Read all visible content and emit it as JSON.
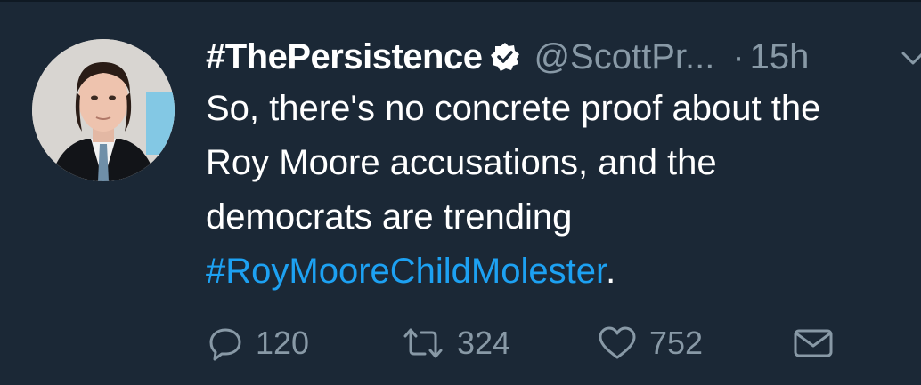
{
  "tweet": {
    "display_name": "#ThePersistence",
    "handle": "@ScottPr...",
    "separator": "·",
    "time": "15h",
    "text_line1": "So, there's no concrete proof about the",
    "text_line2": "Roy Moore accusations, and the",
    "text_line3": "democrats are trending",
    "hashtag": "#RoyMooreChildMolester",
    "trailing": "."
  },
  "actions": {
    "reply_count": "120",
    "retweet_count": "324",
    "like_count": "752"
  },
  "icons": {
    "avatar": "user-avatar",
    "verified": "verified-badge-icon",
    "menu": "chevron-down-icon",
    "reply": "reply-icon",
    "retweet": "retweet-icon",
    "like": "heart-icon",
    "dm": "envelope-icon"
  },
  "colors": {
    "background": "#1b2836",
    "text": "#ffffff",
    "muted": "#8899a6",
    "link": "#1da1f2"
  }
}
